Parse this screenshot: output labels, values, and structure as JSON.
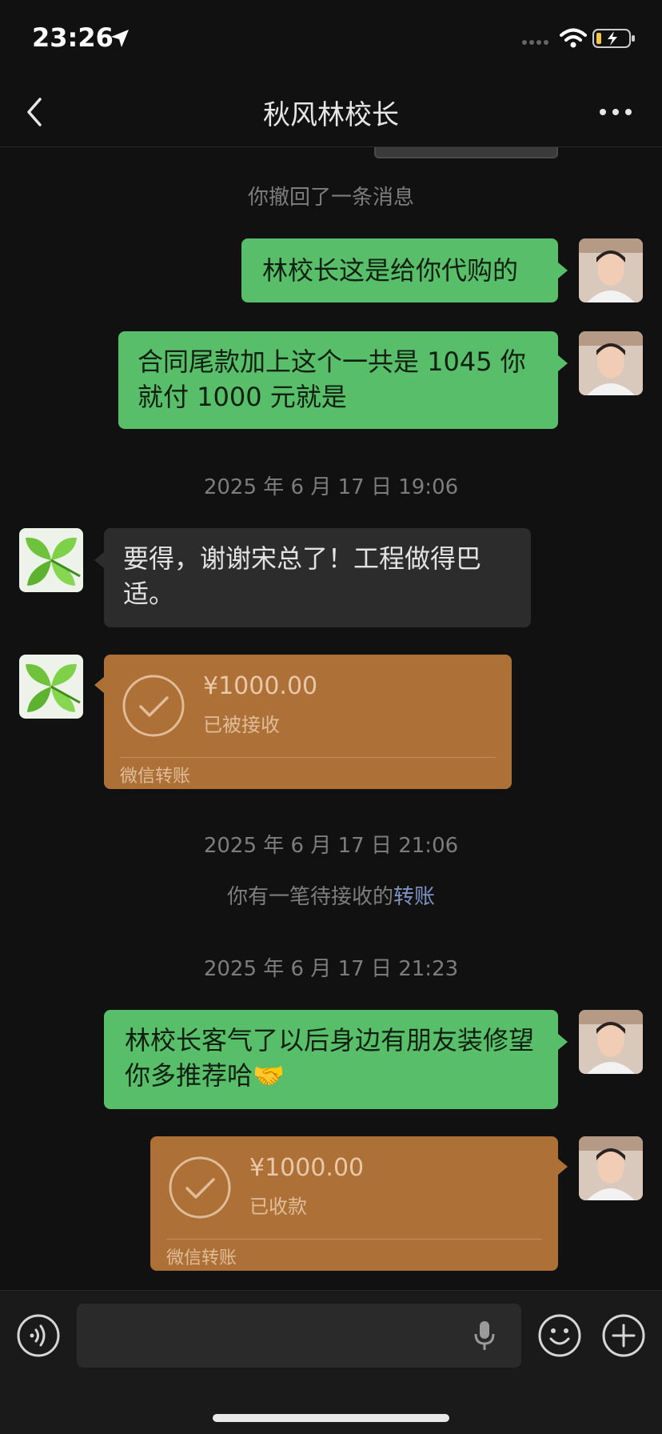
{
  "status_bar": {
    "time": "23:26"
  },
  "header": {
    "title": "秋风林校长"
  },
  "messages": {
    "recall_notice": "你撤回了一条消息",
    "msg1": "林校长这是给你代购的",
    "msg2": "合同尾款加上这个一共是 1045 你就付 1000 元就是",
    "time1": "2025 年 6 月 17 日 19:06",
    "msg3": "要得，谢谢宋总了！工程做得巴适。",
    "transfer1": {
      "amount": "¥1000.00",
      "status": "已被接收",
      "label": "微信转账"
    },
    "time2": "2025 年 6 月 17 日 21:06",
    "pending_notice": "你有一笔待接收的",
    "pending_link": "转账",
    "time3": "2025 年 6 月 17 日 21:23",
    "msg4": "林校长客气了以后身边有朋友装修望你多推荐哈🤝",
    "transfer2": {
      "amount": "¥1000.00",
      "status": "已收款",
      "label": "微信转账"
    }
  },
  "colors": {
    "my_bubble": "#58be6a",
    "their_bubble": "#2c2c2c",
    "transfer_card": "#ad7138",
    "link": "#7e93c1",
    "background": "#111111"
  },
  "icons": [
    "location-arrow-icon",
    "signal-icon",
    "wifi-icon",
    "battery-charging-icon",
    "back-chevron-icon",
    "more-dots-icon",
    "check-circle-icon",
    "voice-icon",
    "mic-icon",
    "emoji-icon",
    "plus-icon"
  ]
}
